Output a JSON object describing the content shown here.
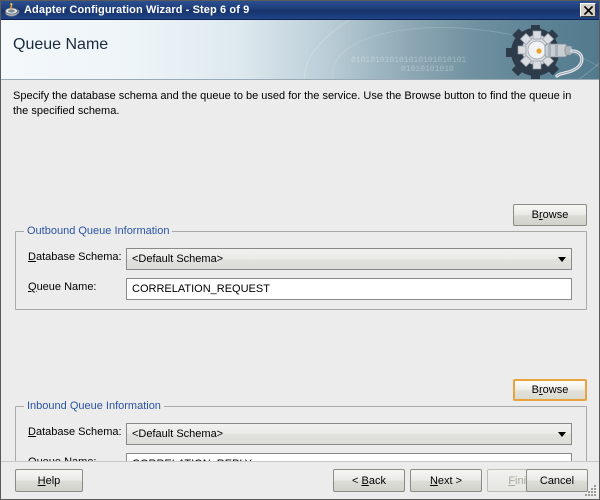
{
  "window": {
    "title": "Adapter Configuration Wizard - Step 6 of 9",
    "icon": "java-coffee-cup-icon",
    "close_label": "×"
  },
  "banner": {
    "title": "Queue Name",
    "binary_line_1": "010101010101010101010101",
    "binary_line_2": "01010101010",
    "art": "gear-and-plug-graphic"
  },
  "instructions": "Specify the database schema and the queue to be used for the service. Use the Browse button to find the queue in the specified schema.",
  "outbound": {
    "browse_label_pre": "B",
    "browse_label_mnemonic": "r",
    "browse_label_post": "owse",
    "legend": "Outbound Queue Information",
    "schema_label_mnemonic": "D",
    "schema_label_rest": "atabase Schema:",
    "schema_value": "<Default Schema>",
    "queue_label_mnemonic": "Q",
    "queue_label_rest": "ueue Name:",
    "queue_value": "CORRELATION_REQUEST"
  },
  "inbound": {
    "browse_label_pre": "B",
    "browse_label_mnemonic": "r",
    "browse_label_post": "owse",
    "legend": "Inbound Queue Information",
    "schema_label_mnemonic": "D",
    "schema_label_rest": "atabase Schema:",
    "schema_value": "<Default Schema>",
    "queue_label_mnemonic": "Q",
    "queue_label_rest": "ueue Name:",
    "queue_value": "CORRELATION_REPLY"
  },
  "footer": {
    "help_mnemonic": "H",
    "help_rest": "elp",
    "back_pre": "< ",
    "back_mnemonic": "B",
    "back_rest": "ack",
    "next_mnemonic": "N",
    "next_rest": "ext >",
    "finish_mnemonic": "F",
    "finish_rest": "inish",
    "cancel_label": "Cancel"
  },
  "colors": {
    "titlebar_blue": "#1c3b78",
    "legend_blue": "#2a54a5",
    "dialog_gray": "#ececec",
    "focus_orange": "#e8a33d",
    "disabled_gray": "#a9a9a0"
  }
}
